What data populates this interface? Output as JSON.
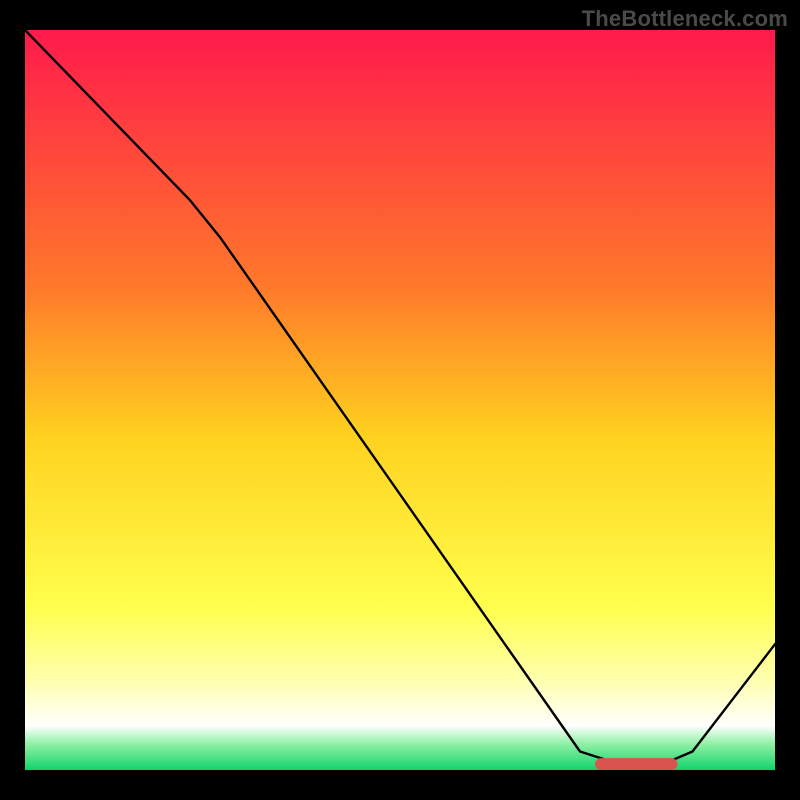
{
  "watermark": "TheBottleneck.com",
  "chart_data": {
    "type": "line",
    "title": "",
    "xlabel": "",
    "ylabel": "",
    "xlim": [
      0,
      100
    ],
    "ylim": [
      0,
      100
    ],
    "grid": false,
    "background_gradient": [
      {
        "offset": 0.0,
        "color": "#ff1a4b"
      },
      {
        "offset": 0.35,
        "color": "#ff7a2a"
      },
      {
        "offset": 0.55,
        "color": "#ffd21f"
      },
      {
        "offset": 0.78,
        "color": "#ffff4d"
      },
      {
        "offset": 0.88,
        "color": "#ffffb0"
      },
      {
        "offset": 0.94,
        "color": "#ffffff"
      },
      {
        "offset": 0.965,
        "color": "#8ff0a4"
      },
      {
        "offset": 1.0,
        "color": "#12d36a"
      }
    ],
    "series": [
      {
        "name": "bottleneck-curve",
        "stroke": "#000000",
        "stroke_width": 2.4,
        "points": [
          {
            "x": 0,
            "y": 100
          },
          {
            "x": 22,
            "y": 77
          },
          {
            "x": 26,
            "y": 72
          },
          {
            "x": 74,
            "y": 2.5
          },
          {
            "x": 78,
            "y": 1.2
          },
          {
            "x": 86,
            "y": 1.2
          },
          {
            "x": 89,
            "y": 2.5
          },
          {
            "x": 100,
            "y": 17
          }
        ]
      }
    ],
    "marker": {
      "name": "optimal-range-marker",
      "color": "#d9534f",
      "x_start": 76,
      "x_end": 87,
      "y": 0.8,
      "thickness": 1.6
    }
  }
}
